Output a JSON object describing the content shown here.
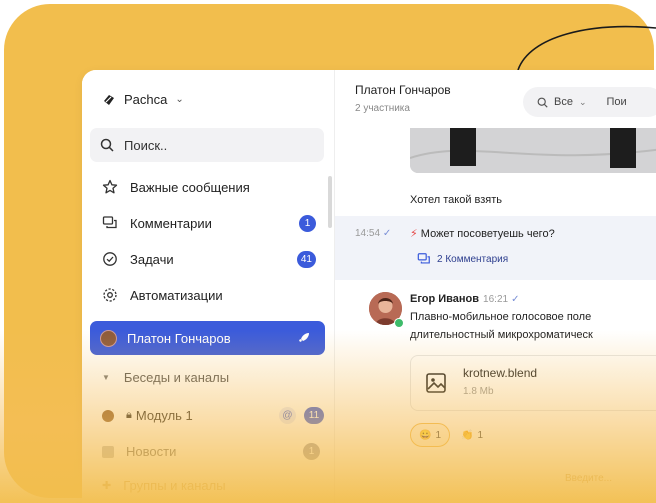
{
  "colors": {
    "background": "#F2BE4D",
    "accent": "#3B5BDB",
    "badge_gray": "#9A9AA8",
    "online": "#3DBB6A"
  },
  "sidebar": {
    "workspace": {
      "name": "Pachca",
      "icon": "pachca-logo-icon"
    },
    "search_placeholder": "Поиск..",
    "items": [
      {
        "label": "Важные сообщения",
        "icon": "star-icon",
        "badge": ""
      },
      {
        "label": "Комментарии",
        "icon": "comments-icon",
        "badge": "1"
      },
      {
        "label": "Задачи",
        "icon": "tasks-icon",
        "badge": "41"
      },
      {
        "label": "Автоматизации",
        "icon": "automation-icon",
        "badge": ""
      }
    ],
    "active_chat": {
      "name": "Платон Гончаров",
      "icon": "rocket-icon"
    },
    "section_title": "Беседы и каналы",
    "channels": [
      {
        "name": "Модуль 1",
        "mention": "@",
        "badge": "11"
      },
      {
        "name": "Новости",
        "badge": "1"
      },
      {
        "name": "Группы и каналы"
      }
    ]
  },
  "chat": {
    "title": "Платон Гончаров",
    "subtitle": "2 участника",
    "filter": {
      "label": "Все",
      "extra": "Пои"
    },
    "messages": [
      {
        "text": "Хотел такой взять"
      },
      {
        "time": "14:54",
        "text": "Может посоветуешь чего?",
        "comments": "2 Комментария"
      }
    ],
    "post": {
      "author": "Егор Иванов",
      "time": "16:21",
      "lines": [
        "Плавно-мобильное голосовое поле",
        "длительностный микрохроматическ"
      ],
      "file": {
        "name": "krotnew.blend",
        "size": "1.8 Mb"
      },
      "reactions": [
        {
          "emoji": "😀",
          "count": "1"
        },
        {
          "emoji": "👏",
          "count": "1"
        }
      ]
    },
    "footer_hint": "Введите..."
  }
}
